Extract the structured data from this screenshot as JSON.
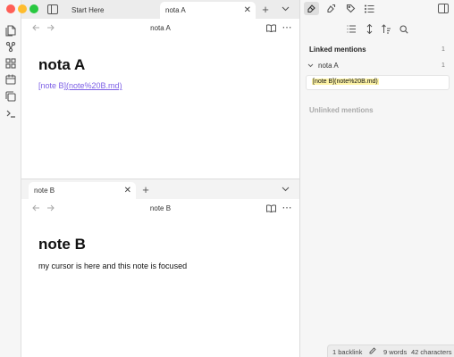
{
  "window": {
    "traffic_lights": {
      "close": "#ff5f57",
      "minimize": "#febc2e",
      "zoom": "#28c840"
    }
  },
  "tabs": [
    {
      "label": "Start Here",
      "active": false
    },
    {
      "label": "nota A",
      "active": true
    }
  ],
  "ribbon": {
    "icons": [
      "files-icon",
      "graph-icon",
      "canvas-icon",
      "calendar-icon",
      "copy-icon",
      "terminal-icon"
    ]
  },
  "pane1": {
    "nav_title": "nota A",
    "heading": "nota A",
    "link_text": "[note B]",
    "link_url": "(note%20B.md)"
  },
  "pane2": {
    "tab_label": "note B",
    "nav_title": "note B",
    "heading": "note B",
    "paragraph": "my cursor is here and this note is focused"
  },
  "sidebar": {
    "linked_title": "Linked mentions",
    "linked_count": "1",
    "file_name": "nota A",
    "file_count": "1",
    "mention_text": "[note B](note%20B.md)",
    "unlinked_title": "Unlinked mentions"
  },
  "status": {
    "backlinks": "1 backlink",
    "words": "9 words",
    "characters": "42 characters"
  },
  "colors": {
    "accent": "#7c5fe6",
    "highlight": "#fdf3a6"
  }
}
